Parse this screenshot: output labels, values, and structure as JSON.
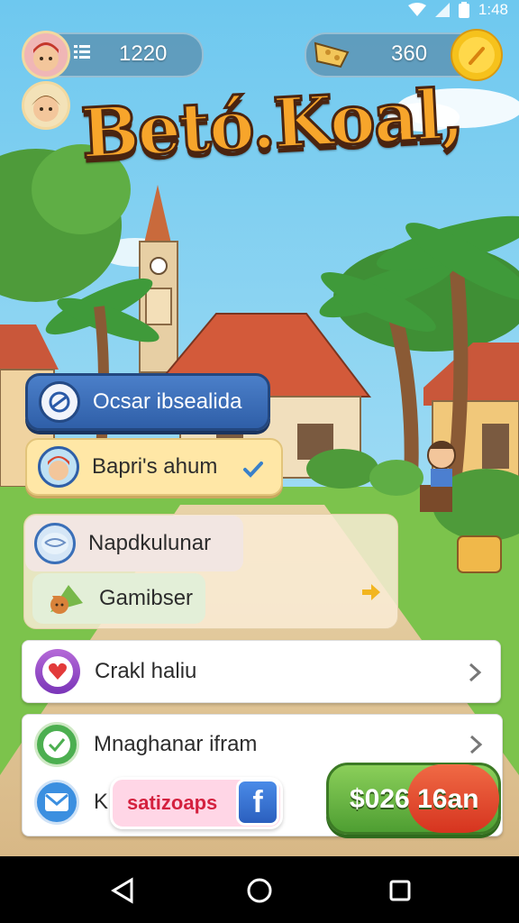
{
  "status_bar": {
    "time": "1:48"
  },
  "hud": {
    "player_score": "1220",
    "currency_amount": "360",
    "menu_icon": "list-icon"
  },
  "title": "Betó.Koal,",
  "menu": {
    "item1": {
      "label": "Ocsar ibsealida",
      "icon": "swap-icon"
    },
    "item2": {
      "label": "Bapri's ahum",
      "icon": "player-avatar"
    },
    "item3": {
      "label": "Napdkulunar",
      "icon": "map-globe-icon"
    },
    "item4": {
      "label": "Gamibser",
      "icon": "fox-icon"
    },
    "item5": {
      "label": "Crakl haliu",
      "icon": "heart-icon"
    },
    "item6": {
      "label": "Mnaghanar ifram",
      "icon": "chat-icon"
    },
    "item7": {
      "label": "K",
      "icon": "mail-icon"
    },
    "social_pill": "satizoaps",
    "facebook_letter": "f",
    "cash_button": "$026 16an"
  },
  "colors": {
    "sky_top": "#7fcdf0",
    "grass": "#7cc34c",
    "title_fill": "#f7a52b",
    "accent_blue": "#3a6fb8",
    "accent_yellow": "#ffe7a6",
    "cash_green": "#5aa63a",
    "cash_red": "#e2452b"
  },
  "nav": {
    "back_icon": "back-triangle-icon",
    "home_icon": "home-circle-icon",
    "recent_icon": "recents-square-icon"
  }
}
